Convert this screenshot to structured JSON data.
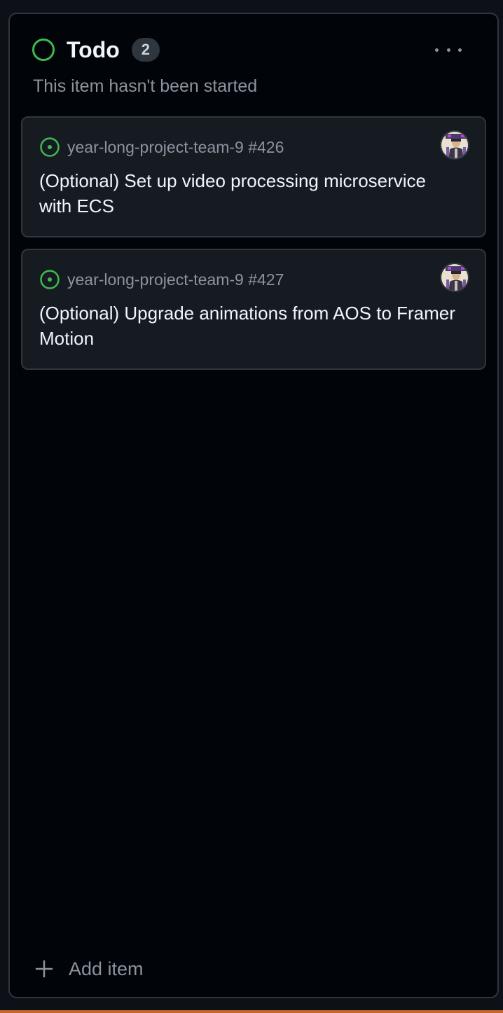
{
  "column": {
    "title": "Todo",
    "count": "2",
    "description": "This item hasn't been started",
    "status_color": "#3fb950"
  },
  "cards": [
    {
      "repo": "year-long-project-team-9 #426",
      "title": "(Optional) Set up video processing microservice with ECS"
    },
    {
      "repo": "year-long-project-team-9 #427",
      "title": "(Optional) Upgrade animations from AOS to Framer Motion"
    }
  ],
  "footer": {
    "add_label": "Add item"
  },
  "icons": {
    "status": "circle-icon",
    "issue": "issue-opened-icon",
    "more": "kebab-horizontal-icon",
    "add": "plus-icon"
  }
}
